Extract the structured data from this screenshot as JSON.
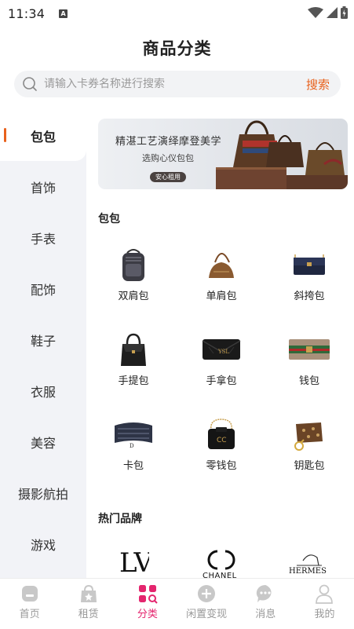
{
  "status_bar": {
    "time": "11:34",
    "notif_letter": "A"
  },
  "header": {
    "title": "商品分类"
  },
  "search": {
    "placeholder": "请输入卡券名称进行搜索",
    "button_label": "搜索"
  },
  "sidebar": {
    "items": [
      {
        "label": "包包",
        "active": true
      },
      {
        "label": "首饰"
      },
      {
        "label": "手表"
      },
      {
        "label": "配饰"
      },
      {
        "label": "鞋子"
      },
      {
        "label": "衣服"
      },
      {
        "label": "美容"
      },
      {
        "label": "摄影航拍"
      },
      {
        "label": "游戏"
      }
    ]
  },
  "banner": {
    "title": "精湛工艺演绎摩登美学",
    "subtitle": "选购心仪包包",
    "button_label": "安心租用"
  },
  "section_bags": {
    "title": "包包",
    "items": [
      {
        "label": "双肩包"
      },
      {
        "label": "单肩包"
      },
      {
        "label": "斜挎包"
      },
      {
        "label": "手提包"
      },
      {
        "label": "手拿包"
      },
      {
        "label": "钱包"
      },
      {
        "label": "卡包"
      },
      {
        "label": "零钱包"
      },
      {
        "label": "钥匙包"
      }
    ]
  },
  "section_brands": {
    "title": "热门品牌",
    "items": [
      {
        "logo_text": "LV"
      },
      {
        "logo_text": "CHANEL"
      },
      {
        "logo_text": "HERMES"
      }
    ]
  },
  "tab_bar": {
    "items": [
      {
        "label": "首页"
      },
      {
        "label": "租赁"
      },
      {
        "label": "分类",
        "active": true
      },
      {
        "label": "闲置变现"
      },
      {
        "label": "消息"
      },
      {
        "label": "我的"
      }
    ]
  },
  "colors": {
    "accent": "#e8611c",
    "tab_active": "#e4256e",
    "sidebar_bg": "#f2f3f7",
    "search_bg": "#f2f3f5"
  }
}
